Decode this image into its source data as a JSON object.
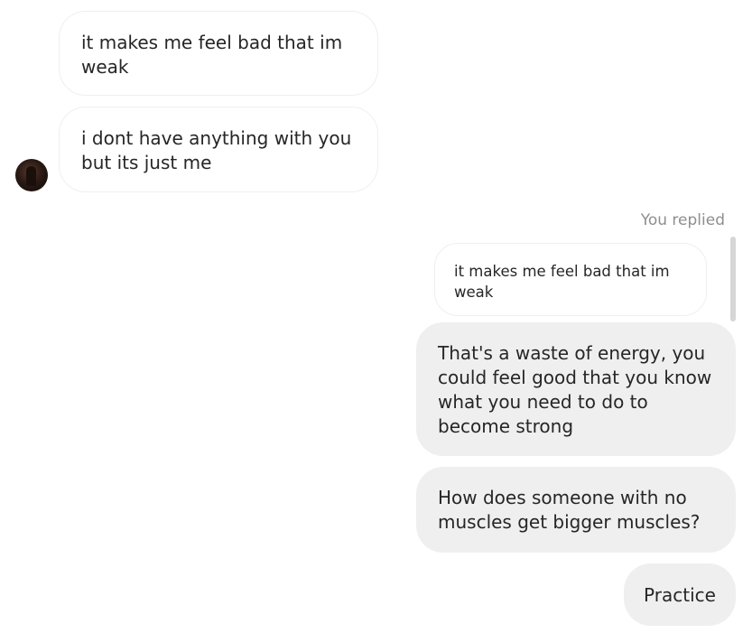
{
  "messages": {
    "incoming": [
      {
        "text": "it makes me feel bad that im weak"
      },
      {
        "text": "i dont have anything with you but its just me"
      }
    ],
    "replied_label": "You replied",
    "quoted_reply": "it makes me feel bad that im weak",
    "outgoing": [
      {
        "text": "That's a waste of energy, you could feel good that you know what you need to do to become strong"
      },
      {
        "text": "How does someone with no muscles get bigger muscles?"
      },
      {
        "text": "Practice"
      }
    ]
  }
}
